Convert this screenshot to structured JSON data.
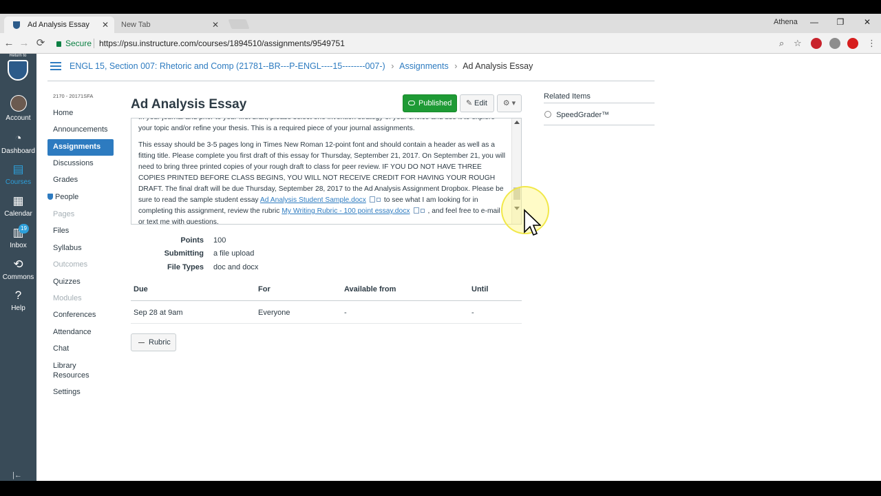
{
  "browser": {
    "tabs": [
      {
        "label": "Ad Analysis Essay",
        "close": "✕"
      },
      {
        "label": "New Tab",
        "close": "✕"
      }
    ],
    "profile_name": "Athena",
    "window_controls": {
      "minimize": "—",
      "maximize": "❐",
      "close": "✕"
    },
    "nav": {
      "back": "←",
      "forward": "→",
      "reload": "⟳"
    },
    "secure_label": "Secure",
    "url": "https://psu.instructure.com/courses/1894510/assignments/9549751"
  },
  "global_nav": {
    "return_label": "Return to",
    "items": [
      {
        "label": "Account",
        "icon": "avatar"
      },
      {
        "label": "Dashboard",
        "icon": "dashboard-icon",
        "glyph": "◔"
      },
      {
        "label": "Courses",
        "icon": "courses-icon",
        "glyph": "▤"
      },
      {
        "label": "Calendar",
        "icon": "calendar-icon",
        "glyph": "▦"
      },
      {
        "label": "Inbox",
        "icon": "inbox-icon",
        "glyph": "▥",
        "badge": "19"
      },
      {
        "label": "Commons",
        "icon": "commons-icon",
        "glyph": "⟲"
      },
      {
        "label": "Help",
        "icon": "help-icon",
        "glyph": "?"
      }
    ],
    "collapse_glyph": "|←"
  },
  "breadcrumb": {
    "course": "ENGL 15, Section 007: Rhetoric and Comp (21781--BR---P-ENGL----15--------007-)",
    "section": "Assignments",
    "current": "Ad Analysis Essay",
    "sep": "›"
  },
  "course_nav": {
    "term": "2170 - 20171SFA",
    "items": [
      {
        "label": "Home",
        "state": "normal"
      },
      {
        "label": "Announcements",
        "state": "normal"
      },
      {
        "label": "Assignments",
        "state": "active"
      },
      {
        "label": "Discussions",
        "state": "normal"
      },
      {
        "label": "Grades",
        "state": "normal"
      },
      {
        "label": "People",
        "state": "normal"
      },
      {
        "label": "Pages",
        "state": "disabled"
      },
      {
        "label": "Files",
        "state": "normal"
      },
      {
        "label": "Syllabus",
        "state": "normal"
      },
      {
        "label": "Outcomes",
        "state": "disabled"
      },
      {
        "label": "Quizzes",
        "state": "normal"
      },
      {
        "label": "Modules",
        "state": "disabled"
      },
      {
        "label": "Conferences",
        "state": "normal"
      },
      {
        "label": "Attendance",
        "state": "normal"
      },
      {
        "label": "Chat",
        "state": "normal"
      },
      {
        "label": "Library Resources",
        "state": "normal"
      },
      {
        "label": "Settings",
        "state": "normal"
      }
    ]
  },
  "assignment": {
    "title": "Ad Analysis Essay",
    "published_label": "Published",
    "edit_label": "Edit",
    "gear_label": "⚙ ▾",
    "description": {
      "p1": "In your journal and prior to your first draft, please select one invention strategy of your choice and use it to explore your topic and/or refine your thesis. This is a required piece of your journal assignments.",
      "p2_a": "This essay should be 3-5 pages long in Times New Roman 12-point font and should contain a header as well as a fitting title. Please complete you first draft of this essay for Thursday, September 21, 2017. On September 21, you will need to bring three printed copies of your rough draft to class for peer review. IF YOU DO NOT HAVE THREE COPIES PRINTED BEFORE CLASS BEGINS, YOU WILL NOT RECEIVE CREDIT FOR HAVING YOUR ROUGH DRAFT. The final draft will be due Thursday, September 28, 2017 to the Ad Analysis Assignment Dropbox. Please be sure to read the sample student essay ",
      "link1": "Ad Analysis Student Sample.docx",
      "p2_b": "to see what I am looking for in completing this assignment, review the rubric ",
      "link2": "My Writing Rubric - 100 point essay.docx",
      "p2_c": ", and feel free to e-mail or text me with questions."
    },
    "details": [
      {
        "label": "Points",
        "value": "100"
      },
      {
        "label": "Submitting",
        "value": "a file upload"
      },
      {
        "label": "File Types",
        "value": "doc and docx"
      }
    ],
    "dates": {
      "headers": [
        "Due",
        "For",
        "Available from",
        "Until"
      ],
      "row": [
        "Sep 28 at 9am",
        "Everyone",
        "-",
        "-"
      ]
    },
    "rubric_label": "Rubric"
  },
  "related": {
    "title": "Related Items",
    "items": [
      "SpeedGrader™"
    ]
  },
  "colors": {
    "accent": "#2d7bc0",
    "published": "#1e9a35",
    "global_nav": "#394b58"
  }
}
